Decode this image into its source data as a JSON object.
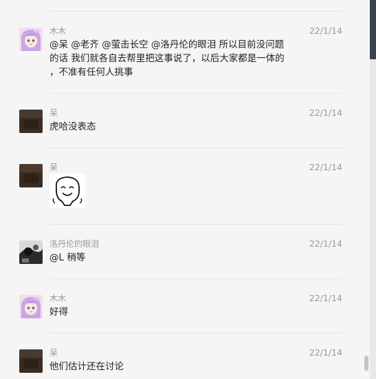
{
  "messages": [
    {
      "sender": "木木",
      "time": "22/1/14",
      "text_lines": [
        "@呆 @老齐 @萤击长空 @洛丹伦的眼泪 所以目前没问题",
        "的话 我们就各自去帮里把这事说了，以后大家都是一体的",
        "，不准有任何人挑事"
      ],
      "avatar": "anime-avatar-icon"
    },
    {
      "sender": "呆",
      "time": "22/1/14",
      "text": "虎哈没表态",
      "avatar": "dark-photo-avatar-icon"
    },
    {
      "sender": "呆",
      "time": "22/1/14",
      "sticker": "smiling-face-sticker-icon",
      "avatar": "dark-photo-avatar-icon"
    },
    {
      "sender": "洛丹伦的眼泪",
      "time": "22/1/14",
      "text": "@L 稍等",
      "avatar": "monochrome-photo-avatar-icon"
    },
    {
      "sender": "木木",
      "time": "22/1/14",
      "text": "好得",
      "avatar": "anime-avatar-icon"
    },
    {
      "sender": "呆",
      "time": "22/1/14",
      "text": "他们估计还在讨论",
      "avatar": "dark-photo-avatar-icon"
    }
  ],
  "colors": {
    "background": "#f5f5f5",
    "divider": "#e4e4e4",
    "meta_text": "#999999",
    "body_text": "#222222"
  }
}
